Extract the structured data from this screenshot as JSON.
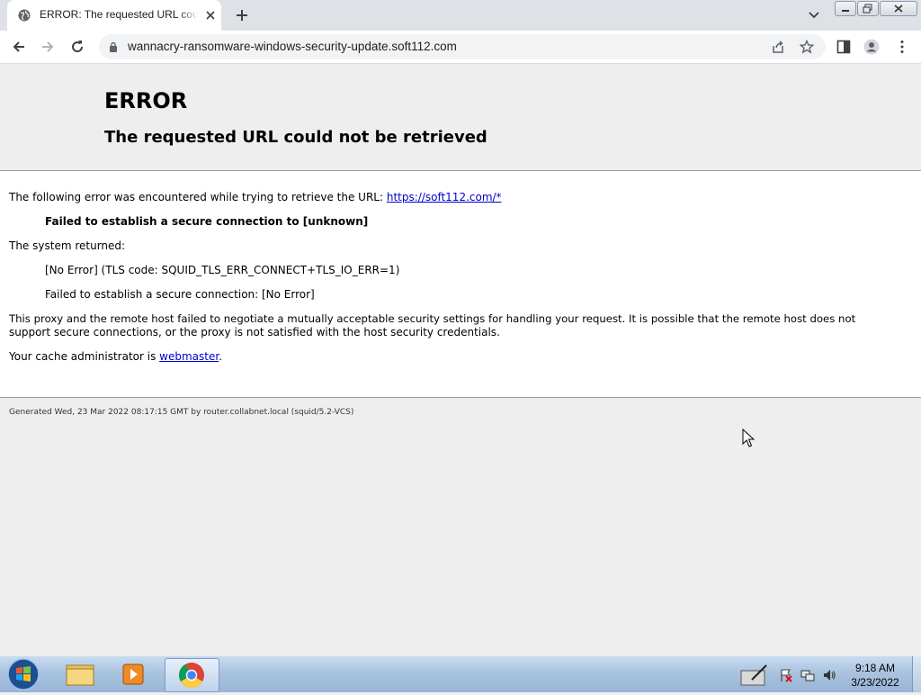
{
  "browser": {
    "tab_title": "ERROR: The requested URL could not be retrieved",
    "url": "wannacry-ransomware-windows-security-update.soft112.com"
  },
  "page": {
    "title": "ERROR",
    "subtitle": "The requested URL could not be retrieved",
    "line1_text": "The following error was encountered while trying to retrieve the URL: ",
    "line1_link": "https://soft112.com/*",
    "error_detail": "Failed to establish a secure connection to [unknown]",
    "system_returned": "The system returned:",
    "tls_code": "[No Error] (TLS code: SQUID_TLS_ERR_CONNECT+TLS_IO_ERR=1)",
    "secure_conn": "Failed to establish a secure connection: [No Error]",
    "explanation_1": "This proxy and the remote host failed to negotiate a mutually acceptable security settings for handling your request. It is possible that the remote host does not",
    "explanation_2": "support secure connections, or the proxy is not satisfied with the host security credentials.",
    "admin_prefix": "Your cache administrator is ",
    "admin_link": "webmaster",
    "admin_suffix": ".",
    "footer": "Generated Wed, 23 Mar 2022 08:17:15 GMT by router.collabnet.local (squid/5.2-VCS)"
  },
  "taskbar": {
    "time": "9:18 AM",
    "date": "3/23/2022"
  },
  "colors": {
    "link": "#0000cc",
    "page_bg": "#eeeeee"
  }
}
